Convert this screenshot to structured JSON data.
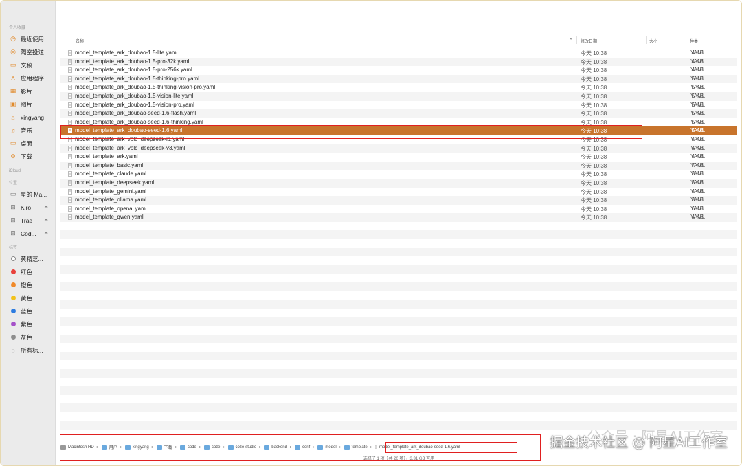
{
  "sidebar": {
    "favorites_label": "个人收藏",
    "favorites": [
      {
        "icon": "clock-icon",
        "glyph": "◷",
        "label": "最近使用"
      },
      {
        "icon": "airdrop-icon",
        "glyph": "◎",
        "label": "隔空投送"
      },
      {
        "icon": "document-icon",
        "glyph": "▭",
        "label": "文稿"
      },
      {
        "icon": "applications-icon",
        "glyph": "⋏",
        "label": "应用程序"
      },
      {
        "icon": "movies-icon",
        "glyph": "▦",
        "label": "影片"
      },
      {
        "icon": "pictures-icon",
        "glyph": "▣",
        "label": "图片"
      },
      {
        "icon": "home-icon",
        "glyph": "⌂",
        "label": "xingyang"
      },
      {
        "icon": "music-icon",
        "glyph": "♫",
        "label": "音乐"
      },
      {
        "icon": "desktop-icon",
        "glyph": "▭",
        "label": "桌面"
      },
      {
        "icon": "downloads-icon",
        "glyph": "⊙",
        "label": "下载"
      }
    ],
    "icloud_label": "iCloud",
    "locations_label": "位置",
    "locations": [
      {
        "icon": "laptop-icon",
        "label": "星的 Ma...",
        "eject": false
      },
      {
        "icon": "drive-icon",
        "label": "Kiro",
        "eject": true
      },
      {
        "icon": "drive-icon",
        "label": "Trae",
        "eject": true
      },
      {
        "icon": "drive-icon",
        "label": "Cod...",
        "eject": true
      }
    ],
    "tags_label": "标签",
    "tags": [
      {
        "label": "黄精芝...",
        "color": "#ffffff"
      },
      {
        "label": "红色",
        "color": "#e8413b"
      },
      {
        "label": "橙色",
        "color": "#f0892a"
      },
      {
        "label": "黄色",
        "color": "#f2c21b"
      },
      {
        "label": "蓝色",
        "color": "#2d7ce0"
      },
      {
        "label": "紫色",
        "color": "#a551c9"
      },
      {
        "label": "灰色",
        "color": "#8e8e8e"
      },
      {
        "label": "所有标...",
        "color": "none"
      }
    ]
  },
  "columns": {
    "name": "名称",
    "date": "修改日期",
    "size": "大小",
    "kind": "种类"
  },
  "files": [
    {
      "name": "model_template_ark_doubao-1.5-lite.yaml",
      "date": "今天 10:38",
      "size": "4 KB",
      "kind": "YAML"
    },
    {
      "name": "model_template_ark_doubao-1.5-pro-32k.yaml",
      "date": "今天 10:38",
      "size": "4 KB",
      "kind": "YAML"
    },
    {
      "name": "model_template_ark_doubao-1.5-pro-256k.yaml",
      "date": "今天 10:38",
      "size": "4 KB",
      "kind": "YAML"
    },
    {
      "name": "model_template_ark_doubao-1.5-thinking-pro.yaml",
      "date": "今天 10:38",
      "size": "5 KB",
      "kind": "YAML"
    },
    {
      "name": "model_template_ark_doubao-1.5-thinking-vision-pro.yaml",
      "date": "今天 10:38",
      "size": "5 KB",
      "kind": "YAML"
    },
    {
      "name": "model_template_ark_doubao-1.5-vision-lite.yaml",
      "date": "今天 10:38",
      "size": "5 KB",
      "kind": "YAML"
    },
    {
      "name": "model_template_ark_doubao-1.5-vision-pro.yaml",
      "date": "今天 10:38",
      "size": "5 KB",
      "kind": "YAML"
    },
    {
      "name": "model_template_ark_doubao-seed-1.6-flash.yaml",
      "date": "今天 10:38",
      "size": "5 KB",
      "kind": "YAML"
    },
    {
      "name": "model_template_ark_doubao-seed-1.6-thinking.yaml",
      "date": "今天 10:38",
      "size": "5 KB",
      "kind": "YAML"
    },
    {
      "name": "model_template_ark_doubao-seed-1.6.yaml",
      "date": "今天 10:38",
      "size": "5 KB",
      "kind": "YAML",
      "selected": true
    },
    {
      "name": "model_template_ark_volc_deepseek-r1.yaml",
      "date": "今天 10:38",
      "size": "4 KB",
      "kind": "YAML"
    },
    {
      "name": "model_template_ark_volc_deepseek-v3.yaml",
      "date": "今天 10:38",
      "size": "4 KB",
      "kind": "YAML"
    },
    {
      "name": "model_template_ark.yaml",
      "date": "今天 10:38",
      "size": "4 KB",
      "kind": "YAML"
    },
    {
      "name": "model_template_basic.yaml",
      "date": "今天 10:38",
      "size": "7 KB",
      "kind": "YAML"
    },
    {
      "name": "model_template_claude.yaml",
      "date": "今天 10:38",
      "size": "3 KB",
      "kind": "YAML"
    },
    {
      "name": "model_template_deepseek.yaml",
      "date": "今天 10:38",
      "size": "3 KB",
      "kind": "YAML"
    },
    {
      "name": "model_template_gemini.yaml",
      "date": "今天 10:38",
      "size": "4 KB",
      "kind": "YAML"
    },
    {
      "name": "model_template_ollama.yaml",
      "date": "今天 10:38",
      "size": "3 KB",
      "kind": "YAML"
    },
    {
      "name": "model_template_openai.yaml",
      "date": "今天 10:38",
      "size": "6 KB",
      "kind": "YAML"
    },
    {
      "name": "model_template_qwen.yaml",
      "date": "今天 10:38",
      "size": "4 KB",
      "kind": "YAML"
    }
  ],
  "pathbar": {
    "root": "Macintosh HD",
    "folders": [
      "用户",
      "xingyang",
      "下载",
      "code",
      "coze",
      "coze-studio",
      "backend",
      "conf",
      "model",
      "template"
    ],
    "file": "model_template_ark_doubao-seed-1.6.yaml"
  },
  "status": "选择了 1 项（共 20 项），3.31 GB 可用",
  "watermark": {
    "faded": "公众号 · 阿星AI工作室",
    "main": "掘金技术社区 @ 阿星AI工作室"
  },
  "colors": {
    "selection": "#c8742c",
    "annotation": "#e02020"
  }
}
